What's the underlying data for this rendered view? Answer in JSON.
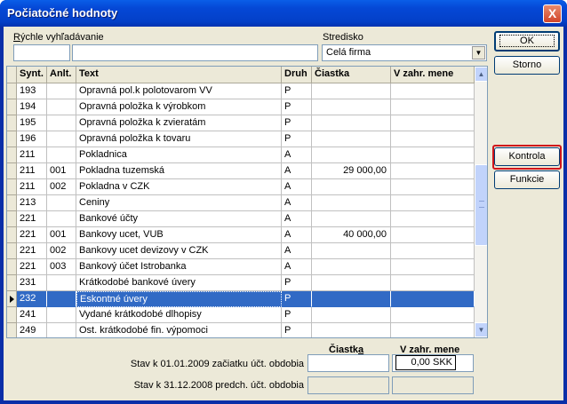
{
  "window": {
    "title": "Počiatočné hodnoty",
    "close_label": "X"
  },
  "search": {
    "label_prefix": "R",
    "label_rest": "ýchle vyhľadávanie",
    "value1": "",
    "value2": ""
  },
  "stredisko": {
    "label": "Stredisko",
    "value": "Celá firma"
  },
  "buttons": {
    "ok": "OK",
    "storno": "Storno",
    "kontrola": "Kontrola",
    "funkcie": "Funkcie"
  },
  "table": {
    "headers": [
      "Synt.",
      "Anlt.",
      "Text",
      "Druh",
      "Čiastka",
      "V zahr. mene"
    ],
    "rows": [
      {
        "synt": "193",
        "anlt": "",
        "text": "Opravná pol.k polotovarom VV",
        "druh": "P",
        "ciastka": "",
        "zahr": ""
      },
      {
        "synt": "194",
        "anlt": "",
        "text": "Opravná položka k výrobkom",
        "druh": "P",
        "ciastka": "",
        "zahr": ""
      },
      {
        "synt": "195",
        "anlt": "",
        "text": "Opravná položka k zvieratám",
        "druh": "P",
        "ciastka": "",
        "zahr": ""
      },
      {
        "synt": "196",
        "anlt": "",
        "text": "Opravná položka k tovaru",
        "druh": "P",
        "ciastka": "",
        "zahr": ""
      },
      {
        "synt": "211",
        "anlt": "",
        "text": "Pokladnica",
        "druh": "A",
        "ciastka": "",
        "zahr": ""
      },
      {
        "synt": "211",
        "anlt": "001",
        "text": "Pokladna tuzemská",
        "druh": "A",
        "ciastka": "29 000,00",
        "zahr": ""
      },
      {
        "synt": "211",
        "anlt": "002",
        "text": "Pokladna v CZK",
        "druh": "A",
        "ciastka": "",
        "zahr": ""
      },
      {
        "synt": "213",
        "anlt": "",
        "text": "Ceniny",
        "druh": "A",
        "ciastka": "",
        "zahr": ""
      },
      {
        "synt": "221",
        "anlt": "",
        "text": "Bankové účty",
        "druh": "A",
        "ciastka": "",
        "zahr": ""
      },
      {
        "synt": "221",
        "anlt": "001",
        "text": "Bankovy ucet, VUB",
        "druh": "A",
        "ciastka": "40 000,00",
        "zahr": ""
      },
      {
        "synt": "221",
        "anlt": "002",
        "text": "Bankovy ucet devizovy v CZK",
        "druh": "A",
        "ciastka": "",
        "zahr": ""
      },
      {
        "synt": "221",
        "anlt": "003",
        "text": "Bankový účet Istrobanka",
        "druh": "A",
        "ciastka": "",
        "zahr": ""
      },
      {
        "synt": "231",
        "anlt": "",
        "text": "Krátkodobé bankové úvery",
        "druh": "P",
        "ciastka": "",
        "zahr": ""
      },
      {
        "synt": "232",
        "anlt": "",
        "text": "Eskontné úvery",
        "druh": "P",
        "ciastka": "",
        "zahr": "",
        "selected": true
      },
      {
        "synt": "241",
        "anlt": "",
        "text": "Vydané krátkodobé dlhopisy",
        "druh": "P",
        "ciastka": "",
        "zahr": ""
      },
      {
        "synt": "249",
        "anlt": "",
        "text": "Ost. krátkodobé fin. výpomoci",
        "druh": "P",
        "ciastka": "",
        "zahr": ""
      }
    ]
  },
  "summary": {
    "ciastka_header_prefix": "Čiastk",
    "ciastka_header_accel": "a",
    "zahr_header": "V zahr. mene",
    "row1_label": "Stav k 01.01.2009 začiatku účt. obdobia",
    "row1_value": "",
    "row1_zahr": "0,00 SKK",
    "row2_label": "Stav k 31.12.2008 predch. účt. obdobia",
    "row2_value": "",
    "row2_zahr": ""
  },
  "colors": {
    "selection": "#316ac5",
    "title_bar": "#0548d6",
    "highlight_ring": "#d0141a"
  }
}
